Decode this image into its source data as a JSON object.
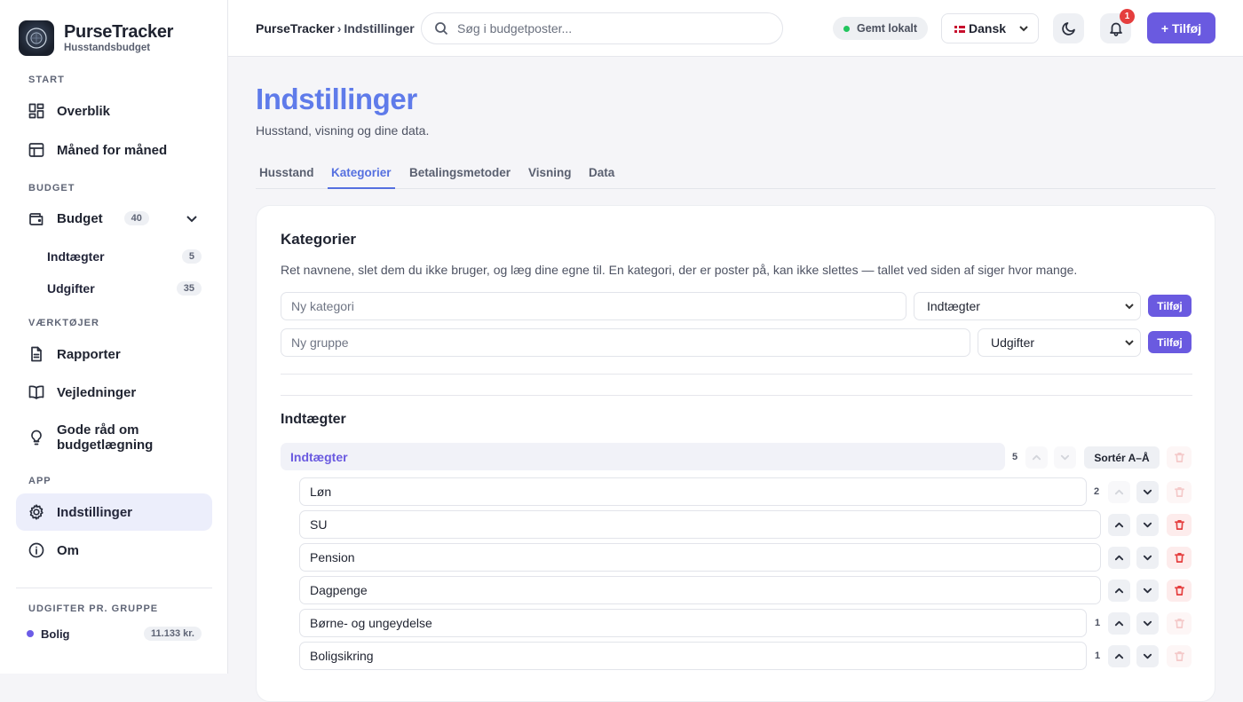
{
  "brand": {
    "name": "PurseTracker",
    "subtitle": "Husstandsbudget"
  },
  "sidebar": {
    "sections": {
      "start": "START",
      "budget": "BUDGET",
      "tools": "VÆRKTØJER",
      "app": "APP",
      "groups": "UDGIFTER PR. GRUPPE"
    },
    "items": {
      "overview": "Overblik",
      "monthly": "Måned for måned",
      "budget": "Budget",
      "budget_count": "40",
      "income": "Indtægter",
      "income_count": "5",
      "expenses": "Udgifter",
      "expenses_count": "35",
      "reports": "Rapporter",
      "guides": "Vejledninger",
      "tips": "Gode råd om budgetlægning",
      "settings": "Indstillinger",
      "about": "Om"
    },
    "group_row": {
      "name": "Bolig",
      "amount": "11.133 kr."
    }
  },
  "topbar": {
    "breadcrumb_root": "PurseTracker",
    "breadcrumb_sep": "›",
    "breadcrumb_current": "Indstillinger",
    "search_placeholder": "Søg i budgetposter...",
    "saved_status": "Gemt lokalt",
    "language": "Dansk",
    "notification_count": "1",
    "add_label": "+ Tilføj"
  },
  "page": {
    "title": "Indstillinger",
    "subtitle": "Husstand, visning og dine data.",
    "tabs": [
      "Husstand",
      "Kategorier",
      "Betalingsmetoder",
      "Visning",
      "Data"
    ],
    "active_tab": "Kategorier"
  },
  "card": {
    "title": "Kategorier",
    "description": "Ret navnene, slet dem du ikke bruger, og læg dine egne til. En kategori, der er poster på, kan ikke slettes — tallet ved siden af siger hvor mange.",
    "new_category_placeholder": "Ny kategori",
    "new_category_type": "Indtægter",
    "new_group_placeholder": "Ny gruppe",
    "new_group_type": "Udgifter",
    "add_button": "Tilføj",
    "section_title": "Indtægter",
    "group_name": "Indtægter",
    "group_count": "5",
    "sort_label": "Sortér A–Å",
    "rows": [
      {
        "name": "Løn",
        "count": "2"
      },
      {
        "name": "SU",
        "count": ""
      },
      {
        "name": "Pension",
        "count": ""
      },
      {
        "name": "Dagpenge",
        "count": ""
      },
      {
        "name": "Børne- og ungeydelse",
        "count": "1"
      },
      {
        "name": "Boligsikring",
        "count": "1"
      }
    ]
  },
  "colors": {
    "accent": "#6a5ae0",
    "title_blue": "#5f7bea",
    "danger": "#e53e3e",
    "saved_dot": "#22c55e"
  }
}
